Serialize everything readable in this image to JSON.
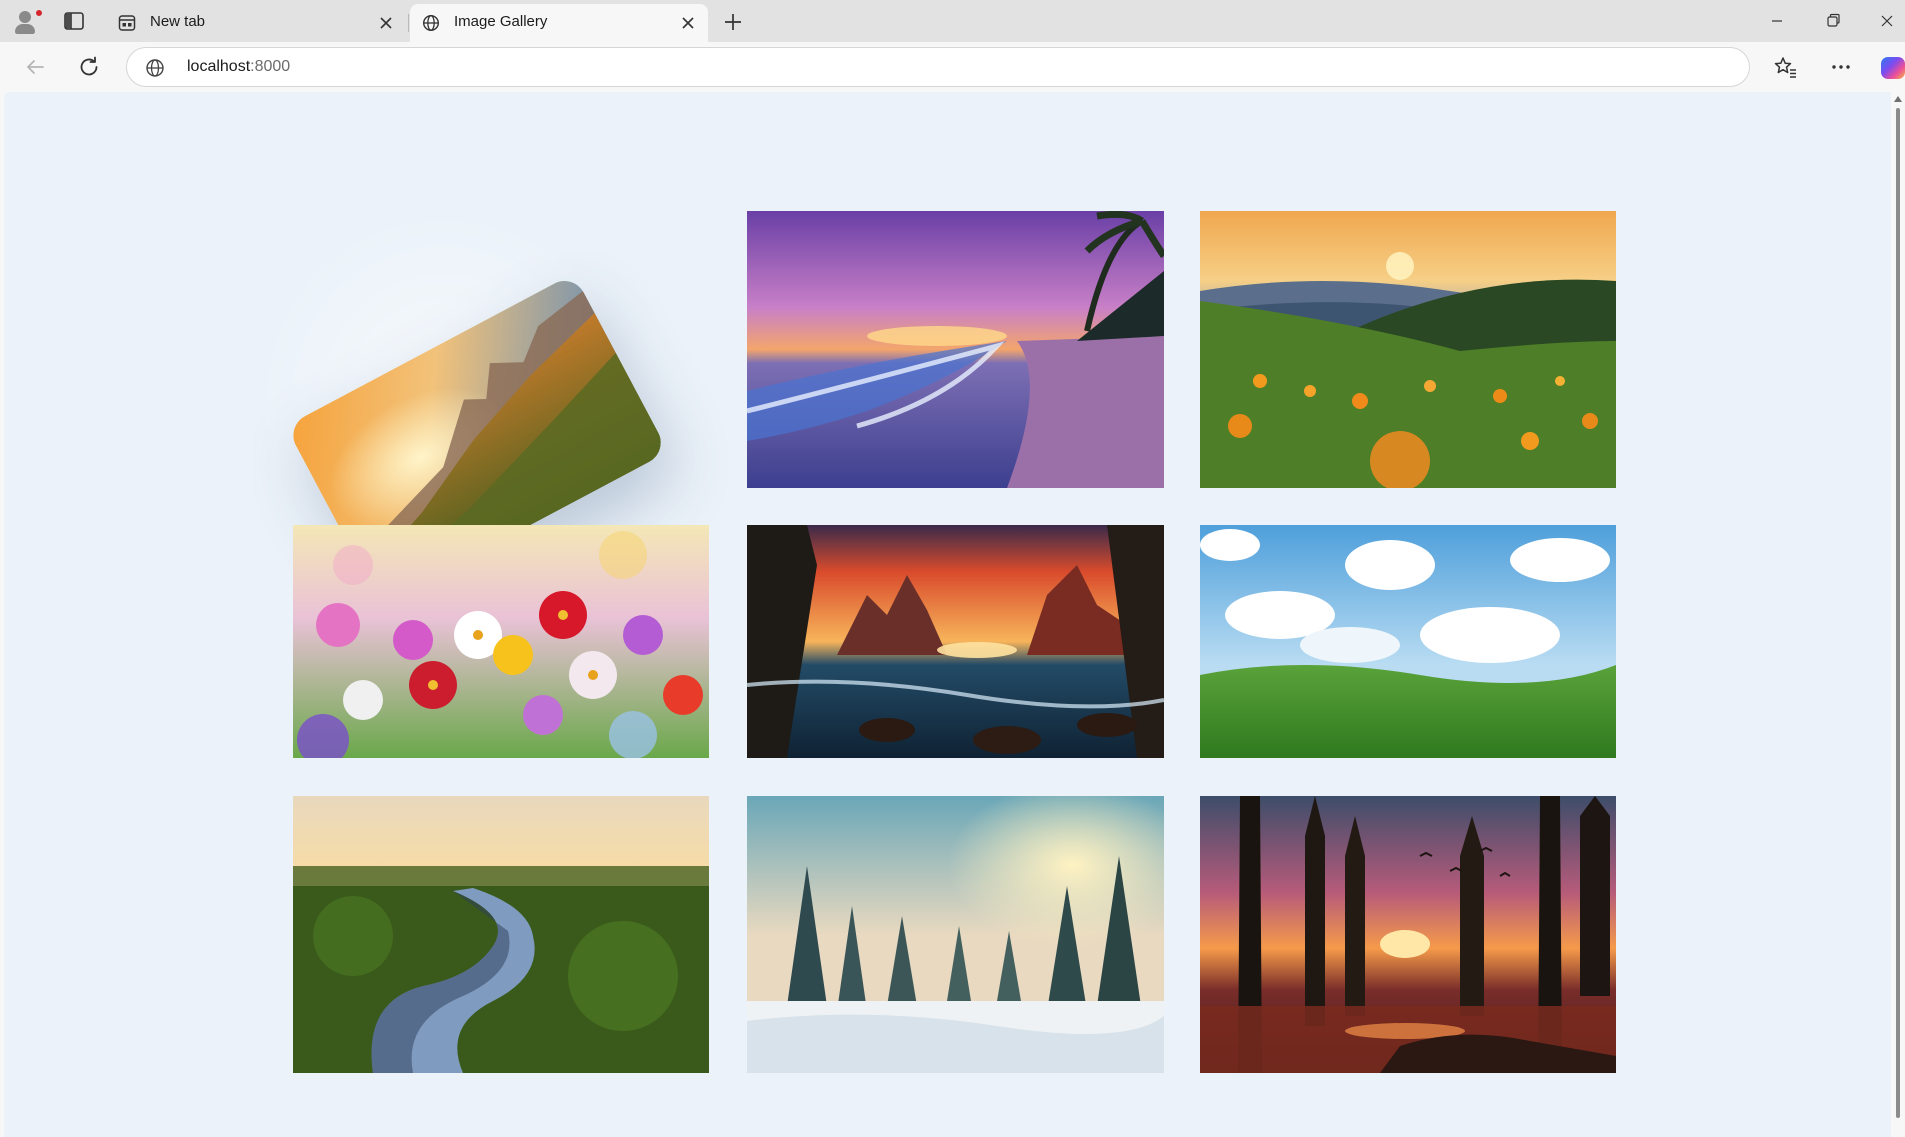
{
  "browser": {
    "tabs": [
      {
        "title": "New tab",
        "icon": "new-tab-page-icon",
        "active": false
      },
      {
        "title": "Image Gallery",
        "icon": "globe-icon",
        "active": true
      }
    ],
    "address": {
      "host": "localhost",
      "port": ":8000"
    }
  },
  "gallery": {
    "images": [
      {
        "name": "mountain-sunset",
        "hovered": true
      },
      {
        "name": "purple-beach-sunset"
      },
      {
        "name": "wildflower-hills-sunset"
      },
      {
        "name": "colorful-cosmos-flowers"
      },
      {
        "name": "tropical-coast-sunset"
      },
      {
        "name": "green-meadow-blue-sky"
      },
      {
        "name": "forest-river-aerial"
      },
      {
        "name": "snowy-pine-forest"
      },
      {
        "name": "forest-lake-sunset-deer"
      }
    ]
  },
  "colors": {
    "page_background": "#ebf2f9",
    "tabstrip": "#e2e2e2",
    "toolbar": "#f7f7f7",
    "profile_badge": "#d5262b"
  }
}
